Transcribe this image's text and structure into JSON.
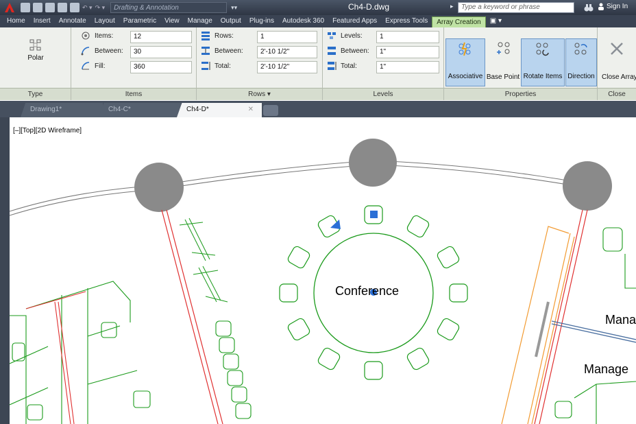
{
  "title_bar": {
    "workspace": "Drafting & Annotation",
    "document": "Ch4-D.dwg",
    "search_placeholder": "Type a keyword or phrase",
    "sign_in": "Sign In"
  },
  "ribbon_tabs": [
    "Home",
    "Insert",
    "Annotate",
    "Layout",
    "Parametric",
    "View",
    "Manage",
    "Output",
    "Plug-ins",
    "Autodesk 360",
    "Featured Apps",
    "Express Tools",
    "Array Creation"
  ],
  "active_tab": "Array Creation",
  "panels": {
    "type": {
      "title": "Type",
      "button": "Polar"
    },
    "items": {
      "title": "Items",
      "items_label": "Items:",
      "items_value": "12",
      "between_label": "Between:",
      "between_value": "30",
      "fill_label": "Fill:",
      "fill_value": "360"
    },
    "rows": {
      "title": "Rows ▾",
      "rows_label": "Rows:",
      "rows_value": "1",
      "between_label": "Between:",
      "between_value": "2'-10 1/2\"",
      "total_label": "Total:",
      "total_value": "2'-10 1/2\""
    },
    "levels": {
      "title": "Levels",
      "levels_label": "Levels:",
      "levels_value": "1",
      "between_label": "Between:",
      "between_value": "1\"",
      "total_label": "Total:",
      "total_value": "1\""
    },
    "properties": {
      "title": "Properties",
      "associative": "Associative",
      "base_point": "Base Point",
      "rotate_items": "Rotate Items",
      "direction": "Direction"
    },
    "close": {
      "title": "Close",
      "close_array": "Close Array"
    }
  },
  "doc_tabs": [
    "Drawing1*",
    "Ch4-C*",
    "Ch4-D*"
  ],
  "active_doc_tab": "Ch4-D*",
  "viewport_label": "[–][Top][2D Wireframe]",
  "drawing_text": {
    "conference": "Conference",
    "manager_top": "Mana",
    "manager_bottom": "Manage"
  },
  "colors": {
    "ribbon_active": "#bfe2a4",
    "furniture": "#1a9a1a",
    "wall_red": "#e03030",
    "wall_orange": "#f29a30",
    "column": "#8a8a8a",
    "grip": "#2b6fd6"
  }
}
